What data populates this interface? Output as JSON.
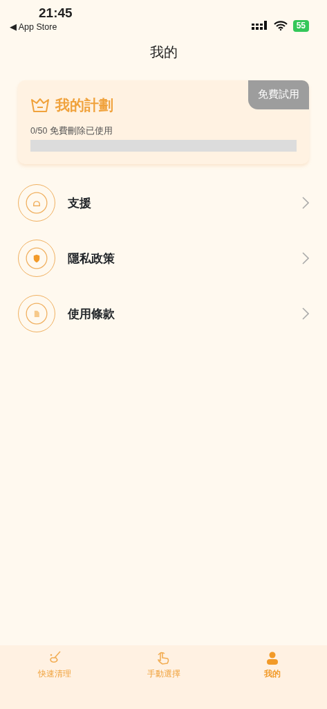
{
  "status_bar": {
    "time": "21:45",
    "back_label": "◀ App Store",
    "battery": "55"
  },
  "title": "我的",
  "plan": {
    "title": "我的計劃",
    "badge": "免費試用",
    "usage": "0/50 免費刪除已使用",
    "level": 0
  },
  "menu": [
    {
      "kind": "support",
      "label": "支援"
    },
    {
      "kind": "privacy",
      "label": "隱私政策"
    },
    {
      "kind": "terms",
      "label": "使用條款"
    }
  ],
  "tabs": [
    {
      "kind": "clean",
      "label": "快速清理",
      "selected": false
    },
    {
      "kind": "manual",
      "label": "手動選擇",
      "selected": false
    },
    {
      "kind": "profile",
      "label": "我的",
      "selected": true
    }
  ]
}
